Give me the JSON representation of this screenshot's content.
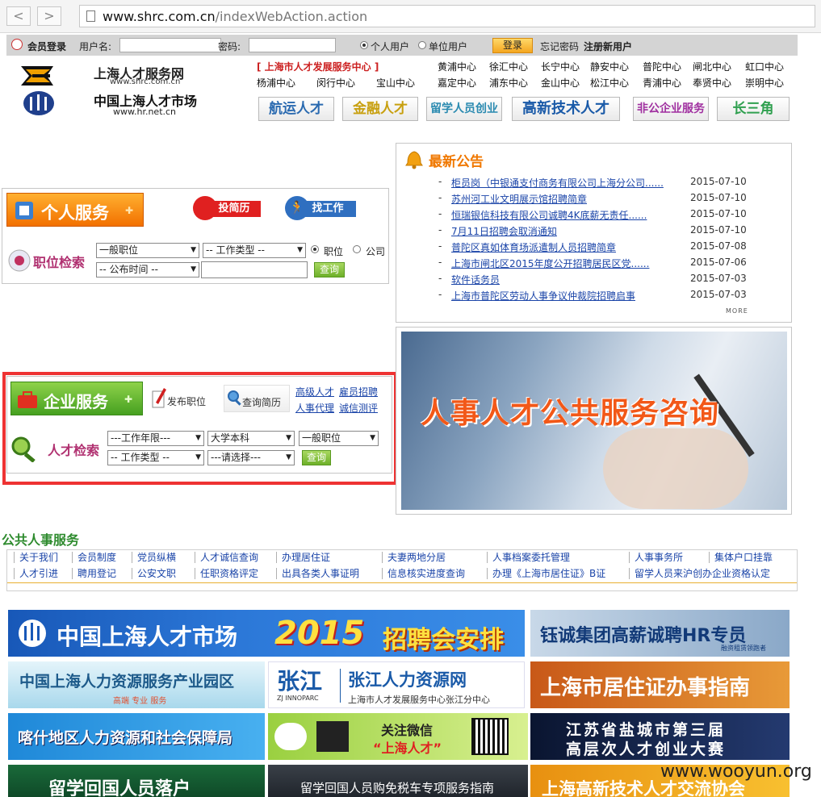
{
  "browser": {
    "url_host": "www.shrc.com.cn",
    "url_path": "/indexWebAction.action",
    "back": "<",
    "forward": ">"
  },
  "login": {
    "title": "会员登录",
    "username_label": "用户名:",
    "password_label": "密码:",
    "personal_user": "个人用户",
    "company_user": "单位用户",
    "login_button": "登录",
    "forgot": "忘记密码",
    "register": "注册新用户"
  },
  "header": {
    "site_name": "上海人才服务网",
    "site_url": "www.shrc.com.cn",
    "market_name": "中国上海人才市场",
    "market_url": "www.hr.net.cn",
    "center_title": "[ 上海市人才发展服务中心 ]",
    "centers_row1": [
      "黄浦中心",
      "徐汇中心",
      "长宁中心",
      "静安中心",
      "普陀中心",
      "闸北中心",
      "虹口中心"
    ],
    "centers_row2": [
      "杨浦中心",
      "闵行中心",
      "宝山中心",
      "嘉定中心",
      "浦东中心",
      "金山中心",
      "松江中心",
      "青浦中心",
      "奉贤中心",
      "崇明中心"
    ],
    "categories": [
      "航运人才",
      "金融人才",
      "留学人员创业",
      "高新技术人才",
      "非公企业服务",
      "长三角"
    ]
  },
  "notice": {
    "title": "最新公告",
    "items": [
      {
        "title": "柜员岗（中银通支付商务有限公司上海分公司......",
        "date": "2015-07-10"
      },
      {
        "title": "苏州河工业文明展示馆招聘简章",
        "date": "2015-07-10"
      },
      {
        "title": "恒瑞银信科技有限公司诚聘4K底薪无责任......",
        "date": "2015-07-10"
      },
      {
        "title": "7月11日招聘会取消通知",
        "date": "2015-07-10"
      },
      {
        "title": "普陀区真如体育场派遣制人员招聘简章",
        "date": "2015-07-08"
      },
      {
        "title": "上海市闸北区2015年度公开招聘居民区党......",
        "date": "2015-07-06"
      },
      {
        "title": "软件话务员",
        "date": "2015-07-03"
      },
      {
        "title": "上海市普陀区劳动人事争议仲裁院招聘启事",
        "date": "2015-07-03"
      }
    ],
    "more": "MORE"
  },
  "personal": {
    "title": "个人服务",
    "submit_resume": "投简历",
    "find_job": "找工作",
    "search_label": "职位检索",
    "sel_position": "一般职位",
    "sel_work_type": "-- 工作类型 --",
    "radio_position": "职位",
    "radio_company": "公司",
    "sel_publish_time": "-- 公布时间 --",
    "query": "查询"
  },
  "enterprise": {
    "title": "企业服务",
    "publish_job": "发布职位",
    "query_resume": "查询简历",
    "links": [
      "高级人才",
      "雇员招聘",
      "人事代理",
      "诚信测评"
    ],
    "search_label": "人才检索",
    "sel_years": "---工作年限---",
    "sel_edu": "大学本科",
    "sel_position": "一般职位",
    "sel_work_type": "-- 工作类型 --",
    "sel_choose": "---请选择---",
    "query": "查询"
  },
  "promo": {
    "text": "人事人才公共服务咨询"
  },
  "public": {
    "title": "公共人事服务",
    "row1": [
      "关于我们",
      "会员制度",
      "党员纵横",
      "人才诚信查询",
      "办理居住证",
      "夫妻两地分居",
      "人事档案委托管理",
      "人事事务所",
      "集体户口挂靠"
    ],
    "row2": [
      "人才引进",
      "聘用登记",
      "公安文职",
      "任职资格评定",
      "出具各类人事证明",
      "信息核实进度查询",
      "办理《上海市居住证》B证",
      "留学人员来沪创办企业资格认定"
    ]
  },
  "banners": {
    "b1_logo": "中国上海人才市场",
    "b1_year": "2015",
    "b1_text": "招聘会安排",
    "b2": "钰诚集团高薪诚聘HR专员",
    "b2_small": "融资租赁领跑者",
    "b3": "中国上海人力资源服务产业园区",
    "b3_sub": "高端 专业 服务",
    "b4_logo": "张江",
    "b4_en": "ZJ INNOPARC",
    "b4_title": "张江人力资源网",
    "b4_sub": "上海市人才发展服务中心张江分中心",
    "b5": "上海市居住证办事指南",
    "b6": "喀什地区人力资源和社会保障局",
    "b7_line1": "关注微信",
    "b7_line2": "“上海人才”",
    "b8_line1": "江苏省盐城市第三届",
    "b8_line2": "高层次人才创业大赛",
    "b9": "留学回国人员落户",
    "b10": "留学回国人员购免税车专项服务指南",
    "b11": "上海高新技术人才交流协会",
    "watermark": "www.wooyun.org"
  },
  "colors": {
    "accent_red": "#ee3333",
    "link_blue": "#1a44a8",
    "green": "#2e8b2e",
    "orange": "#f07800"
  }
}
